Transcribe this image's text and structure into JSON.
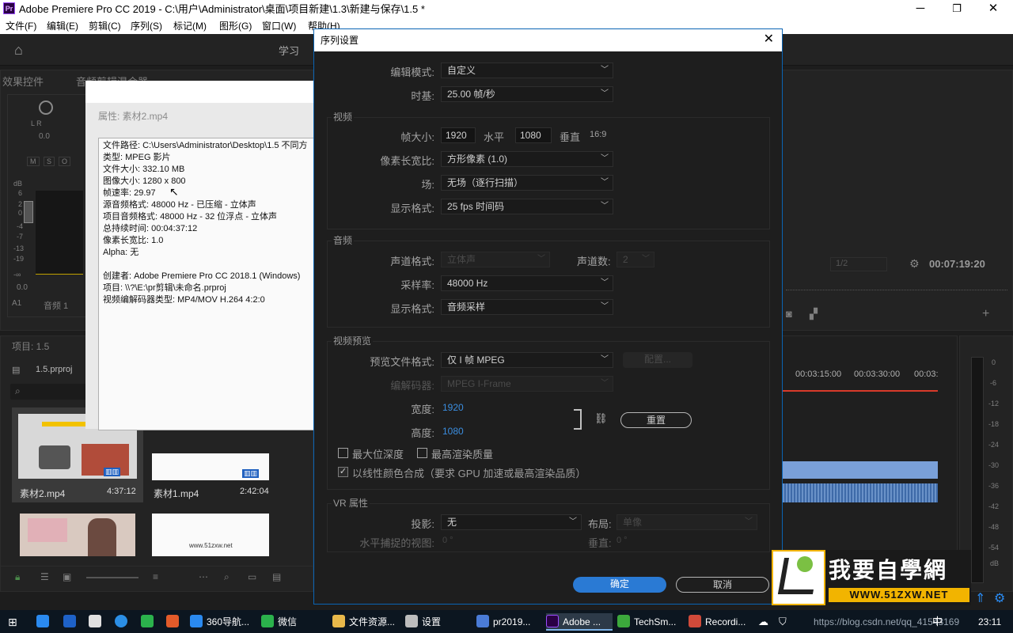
{
  "window": {
    "app_icon": "Pr",
    "title": "Adobe Premiere Pro CC 2019 - C:\\用户\\Administrator\\桌面\\项目新建\\1.3\\新建与保存\\1.5 *",
    "minimize": "─",
    "maximize": "❐",
    "close": "✕"
  },
  "menu": [
    "文件(F)",
    "编辑(E)",
    "剪辑(C)",
    "序列(S)",
    "标记(M)",
    "图形(G)",
    "窗口(W)",
    "帮助(H)"
  ],
  "app": {
    "home_icon": "⌂",
    "workspace_label": "学习",
    "effect_controls_tab": "效果控件",
    "audio_mixer_tab": "音频剪辑混合器",
    "meter_db": "dB",
    "meter_ticks": [
      "6",
      "2",
      "0",
      "-4",
      "-7",
      "-13",
      "-19",
      "-∞"
    ],
    "msm": [
      "M",
      "S",
      "O"
    ],
    "lr": "L    R",
    "pan_value": "0.0",
    "gain_value": "0.0",
    "a1": "A1",
    "audio1": "音频 1",
    "project_tab": "项目: 1.5",
    "project_file": "1.5.prproj",
    "items": [
      {
        "name": "素材2.mp4",
        "duration": "4:37:12"
      },
      {
        "name": "素材1.mp4",
        "duration": "2:42:04"
      }
    ],
    "thumb3_caption": "www.51zxw.net",
    "program_page": "1/2",
    "program_timecode": "00:07:19:20",
    "timeline_ticks": [
      "00:03:15:00",
      "00:03:30:00",
      "00:03:"
    ],
    "right_meter_ticks": [
      "0",
      "-6",
      "-12",
      "-18",
      "-24",
      "-30",
      "-36",
      "-42",
      "-48",
      "-54",
      "dB"
    ]
  },
  "properties": {
    "title": "属性: 素材2.mp4",
    "lines": [
      "文件路径: C:\\Users\\Administrator\\Desktop\\1.5 不同方",
      "类型: MPEG 影片",
      "文件大小: 332.10 MB",
      "图像大小: 1280 x 800",
      "帧速率: 29.97",
      "源音频格式: 48000 Hz - 已压缩 - 立体声",
      "项目音频格式: 48000 Hz - 32 位浮点 - 立体声",
      "总持续时间: 00:04:37:12",
      "像素长宽比: 1.0",
      "Alpha: 无",
      "",
      "创建者: Adobe Premiere Pro CC 2018.1 (Windows)",
      "项目: \\\\?\\E:\\pr剪辑\\未命名.prproj",
      "视频编解码器类型: MP4/MOV H.264 4:2:0"
    ]
  },
  "dialog": {
    "title": "序列设置",
    "close": "✕",
    "edit_mode_label": "编辑模式:",
    "edit_mode_value": "自定义",
    "timebase_label": "时基:",
    "timebase_value": "25.00  帧/秒",
    "video_section": "视频",
    "frame_size_label": "帧大小:",
    "frame_width": "1920",
    "horizontal_label": "水平",
    "frame_height": "1080",
    "vertical_label": "垂直",
    "aspect": "16:9",
    "pixel_aspect_label": "像素长宽比:",
    "pixel_aspect_value": "方形像素 (1.0)",
    "fields_label": "场:",
    "fields_value": "无场（逐行扫描）",
    "video_display_label": "显示格式:",
    "video_display_value": "25 fps 时间码",
    "audio_section": "音频",
    "channel_format_label": "声道格式:",
    "channel_format_value": "立体声",
    "channel_count_label": "声道数:",
    "channel_count_value": "2",
    "sample_rate_label": "采样率:",
    "sample_rate_value": "48000 Hz",
    "audio_display_label": "显示格式:",
    "audio_display_value": "音频采样",
    "preview_section": "视频预览",
    "preview_format_label": "预览文件格式:",
    "preview_format_value": "仅 I 帧 MPEG",
    "configure_label": "配置...",
    "codec_label": "编解码器:",
    "codec_value": "MPEG I-Frame",
    "width_label": "宽度:",
    "width_value": "1920",
    "height_label": "高度:",
    "height_value": "1080",
    "reset_label": "重置",
    "max_bit_depth": "最大位深度",
    "max_render_quality": "最高渲染质量",
    "linear_color": "以线性颜色合成（要求 GPU 加速或最高渲染品质）",
    "vr_section": "VR 属性",
    "projection_label": "投影:",
    "projection_value": "无",
    "layout_label": "布局:",
    "layout_value": "单像",
    "h_view_label": "水平捕捉的视图:",
    "h_view_value": "0 °",
    "v_label": "垂直:",
    "v_value": "0 °",
    "ok_label": "确定",
    "cancel_label": "取消"
  },
  "logo": {
    "title": "我要自學網",
    "url": "WWW.51ZXW.NET"
  },
  "taskbar": {
    "items": [
      {
        "label": "360导航...",
        "color": "#2a8af0"
      },
      {
        "label": "微信",
        "color": "#2bb24c"
      },
      {
        "label": "文件资源...",
        "color": "#e8b84a"
      },
      {
        "label": "设置",
        "color": "#d0d0d0"
      },
      {
        "label": "pr2019...",
        "color": "#4a7bd6"
      },
      {
        "label": "Adobe ...",
        "color": "#9b4dff"
      },
      {
        "label": "TechSm...",
        "color": "#3ca83c"
      },
      {
        "label": "Recordi...",
        "color": "#d04a3a"
      }
    ],
    "watermark": "https://blog.csdn.net/qq_41543169",
    "ime": "中",
    "clock": "23:11"
  }
}
